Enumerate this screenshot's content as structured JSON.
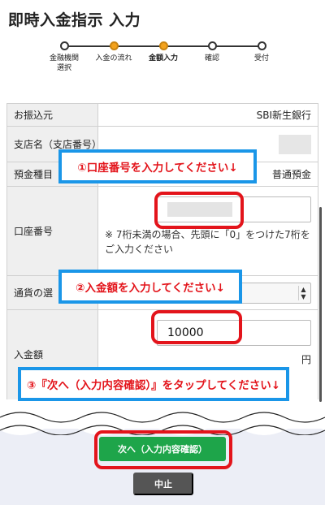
{
  "page": {
    "title": "即時入金指示 入力"
  },
  "stepper": {
    "steps": [
      {
        "label": "金融機関\n選択"
      },
      {
        "label": "入金の流れ"
      },
      {
        "label": "金額入力"
      },
      {
        "label": "確認"
      },
      {
        "label": "受付"
      }
    ],
    "current_index": 2
  },
  "form": {
    "bank_label": "お振込元",
    "bank_value": "SBI新生銀行",
    "branch_label": "支店名（支店番号）",
    "deposit_type_label": "預金種目",
    "deposit_type_value": "普通預金",
    "account_label": "口座番号",
    "account_note": "※ 7桁未満の場合、先頭に「0」をつけた7桁をご入力ください",
    "currency_label": "通貨の選",
    "amount_label": "入金額",
    "amount_value": "10000",
    "amount_unit": "円"
  },
  "callouts": {
    "c1": "①口座番号を入力してください↓",
    "c2": "②入金額を入力してください↓",
    "c3": "③『次へ（入力内容確認）』をタップしてください↓"
  },
  "footer": {
    "next_label": "次へ（入力内容確認）",
    "cancel_label": "中止"
  },
  "colors": {
    "accent": "#f3a21c",
    "primary_button": "#1ea54a",
    "highlight_red": "#e3141b",
    "callout_border": "#1a96e8"
  }
}
